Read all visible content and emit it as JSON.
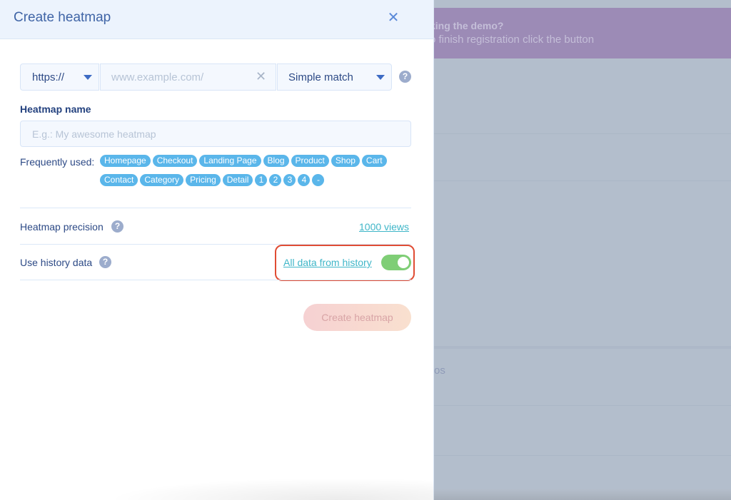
{
  "background": {
    "banner_title": "king the demo?",
    "banner_text": "o finish registration click the button",
    "partial_text": "os"
  },
  "panel": {
    "title": "Create heatmap",
    "close_icon": "close-icon"
  },
  "url_row": {
    "protocol": "https://",
    "url_placeholder": "www.example.com/",
    "url_value": "",
    "match_type": "Simple match",
    "help_icon": "question-circle-icon"
  },
  "name": {
    "label": "Heatmap name",
    "placeholder": "E.g.: My awesome heatmap",
    "value": ""
  },
  "frequently_used": {
    "label": "Frequently used:",
    "tags_row1": [
      "Homepage",
      "Checkout",
      "Landing Page",
      "Blog",
      "Product",
      "Shop",
      "Cart"
    ],
    "tags_row2": [
      "Contact",
      "Category",
      "Pricing",
      "Detail",
      "1",
      "2",
      "3",
      "4",
      "-"
    ]
  },
  "precision": {
    "label": "Heatmap precision",
    "value": "1000 views"
  },
  "history": {
    "label": "Use history data",
    "value": "All data from history",
    "enabled": true
  },
  "actions": {
    "create_label": "Create heatmap"
  },
  "colors": {
    "accent": "#5ab6ea",
    "link": "#3fb6c8",
    "toggle_on": "#7fce76",
    "highlight": "#e04c33",
    "title": "#3f64a6"
  }
}
